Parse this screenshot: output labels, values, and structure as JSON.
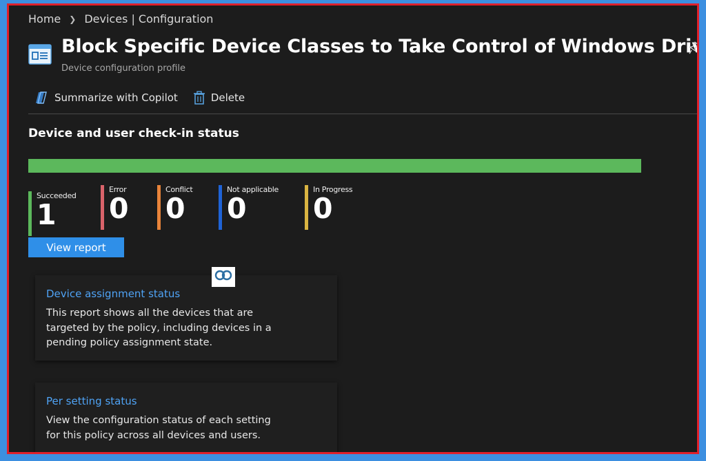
{
  "breadcrumb": {
    "home": "Home",
    "current": "Devices | Configuration"
  },
  "header": {
    "title": "Block Specific Device Classes to Take Control of Windows Drivers",
    "subtitle": "Device configuration profile"
  },
  "toolbar": {
    "copilot_label": "Summarize with Copilot",
    "delete_label": "Delete"
  },
  "status_section": {
    "title": "Device and user check-in status",
    "bar_color": "#5cb85c",
    "succeeded_fraction": 1.0,
    "stats": [
      {
        "label": "Succeeded",
        "value": "1",
        "color": "#5cb85c"
      },
      {
        "label": "Error",
        "value": "0",
        "color": "#d9636a"
      },
      {
        "label": "Conflict",
        "value": "0",
        "color": "#e8833a"
      },
      {
        "label": "Not applicable",
        "value": "0",
        "color": "#1f63d6"
      },
      {
        "label": "In Progress",
        "value": "0",
        "color": "#d9b441"
      }
    ],
    "view_report_label": "View report"
  },
  "cards": [
    {
      "title": "Device assignment status",
      "description": "This report shows all the devices that are targeted by the policy, including devices in a pending policy assignment state."
    },
    {
      "title": "Per setting status",
      "description": "View the configuration status of each setting for this policy across all devices and users."
    }
  ],
  "colors": {
    "accent": "#2f8fe8",
    "link": "#4fa3f5",
    "frame_border": "#e0202a",
    "background": "#1c1c1c"
  },
  "icons": [
    "chevron-right-icon",
    "profile-icon",
    "pin-icon",
    "copilot-icon",
    "trash-icon",
    "watermark-logo"
  ]
}
